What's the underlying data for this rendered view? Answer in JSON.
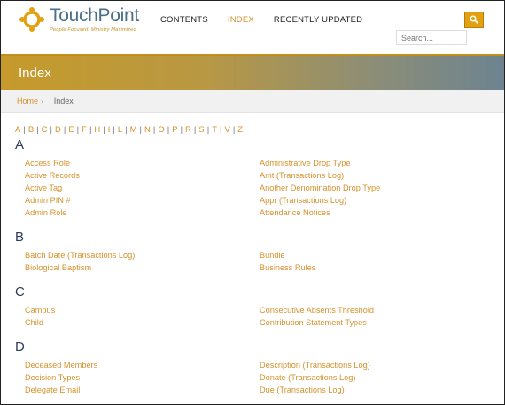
{
  "brand": {
    "name": "TouchPoint",
    "tagline": "People Focused. Ministry Maximized"
  },
  "nav": [
    {
      "label": "CONTENTS",
      "active": false
    },
    {
      "label": "INDEX",
      "active": true
    },
    {
      "label": "RECENTLY UPDATED",
      "active": false
    }
  ],
  "search": {
    "placeholder": "Search...",
    "value": ""
  },
  "banner": {
    "title": "Index"
  },
  "breadcrumb": {
    "home": "Home",
    "separator": "›",
    "current": "Index"
  },
  "alphabet": [
    "A",
    "B",
    "C",
    "D",
    "E",
    "F",
    "H",
    "I",
    "L",
    "M",
    "N",
    "O",
    "P",
    "R",
    "S",
    "T",
    "V",
    "Z"
  ],
  "sections": [
    {
      "letter": "A",
      "left": [
        "Access Role",
        "Active Records",
        "Active Tag",
        "Admin PIN #",
        "Admin Role"
      ],
      "right": [
        "Administrative Drop Type",
        "Amt (Transactions Log)",
        "Another Denomination Drop Type",
        "Appr (Transactions Log)",
        "Attendance Notices"
      ]
    },
    {
      "letter": "B",
      "left": [
        "Batch Date (Transactions Log)",
        "Biological Baptism"
      ],
      "right": [
        "Bundle",
        "Business Rules"
      ]
    },
    {
      "letter": "C",
      "left": [
        "Campus",
        "Child"
      ],
      "right": [
        "Consecutive Absents Threshold",
        "Contribution Statement Types"
      ]
    },
    {
      "letter": "D",
      "left": [
        "Deceased Members",
        "Decision Types",
        "Delegate Email"
      ],
      "right": [
        "Description (Transactions Log)",
        "Donate (Transactions Log)",
        "Due (Transactions Log)"
      ]
    }
  ],
  "colors": {
    "accent": "#d4922d",
    "heading": "#2e3b57",
    "search_button": "#e3a112"
  },
  "icons": {
    "search_button": "search-icon",
    "logo": "touchpoint-logo-icon"
  }
}
